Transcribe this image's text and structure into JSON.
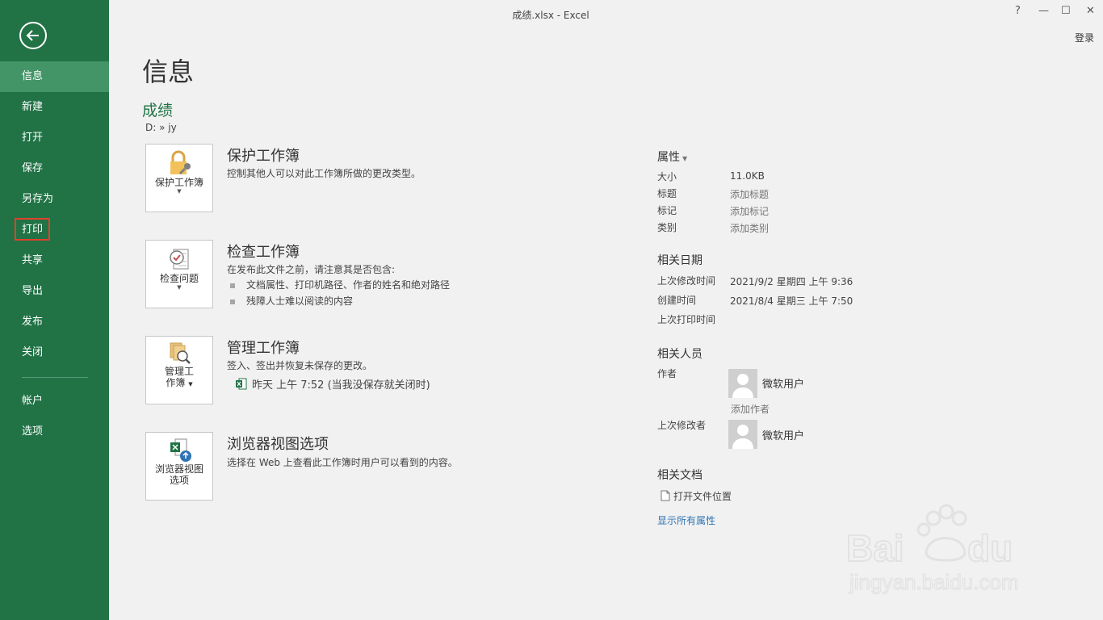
{
  "window": {
    "title": "成绩.xlsx - Excel",
    "help": "?",
    "minimize": "—",
    "maximize": "☐",
    "close": "✕",
    "login": "登录"
  },
  "nav": {
    "items": [
      "信息",
      "新建",
      "打开",
      "保存",
      "另存为",
      "打印",
      "共享",
      "导出",
      "发布",
      "关闭"
    ],
    "items2": [
      "帐户",
      "选项"
    ]
  },
  "page": {
    "title": "信息",
    "doc_name": "成绩",
    "doc_path": "D: » jy"
  },
  "sections": {
    "protect": {
      "tile": "保护工作簿",
      "title": "保护工作簿",
      "desc": "控制其他人可以对此工作簿所做的更改类型。"
    },
    "inspect": {
      "tile": "检查问题",
      "title": "检查工作簿",
      "desc": "在发布此文件之前，请注意其是否包含:",
      "bullets": [
        "文档属性、打印机路径、作者的姓名和绝对路径",
        "残障人士难以阅读的内容"
      ]
    },
    "manage": {
      "tile1": "管理工",
      "tile2": "作簿",
      "title": "管理工作簿",
      "desc": "签入、签出并恢复未保存的更改。",
      "version": "昨天 上午 7:52 (当我没保存就关闭时)"
    },
    "browser": {
      "tile1": "浏览器视图",
      "tile2": "选项",
      "title": "浏览器视图选项",
      "desc": "选择在 Web 上查看此工作簿时用户可以看到的内容。"
    }
  },
  "props": {
    "title": "属性",
    "rows": [
      {
        "label": "大小",
        "value": "11.0KB"
      },
      {
        "label": "标题",
        "value": "添加标题"
      },
      {
        "label": "标记",
        "value": "添加标记"
      },
      {
        "label": "类别",
        "value": "添加类别"
      }
    ],
    "dates_title": "相关日期",
    "dates": [
      {
        "label": "上次修改时间",
        "value": "2021/9/2 星期四 上午 9:36"
      },
      {
        "label": "创建时间",
        "value": "2021/8/4 星期三 上午 7:50"
      },
      {
        "label": "上次打印时间",
        "value": ""
      }
    ],
    "people_title": "相关人员",
    "author_label": "作者",
    "author_name": "微软用户",
    "add_author": "添加作者",
    "modifier_label": "上次修改者",
    "modifier_name": "微软用户",
    "docs_title": "相关文档",
    "open_location": "打开文件位置",
    "show_all": "显示所有属性"
  },
  "colors": {
    "accent": "#217346",
    "active": "#439467",
    "highlight": "#e3402a",
    "link": "#2e74b5"
  }
}
